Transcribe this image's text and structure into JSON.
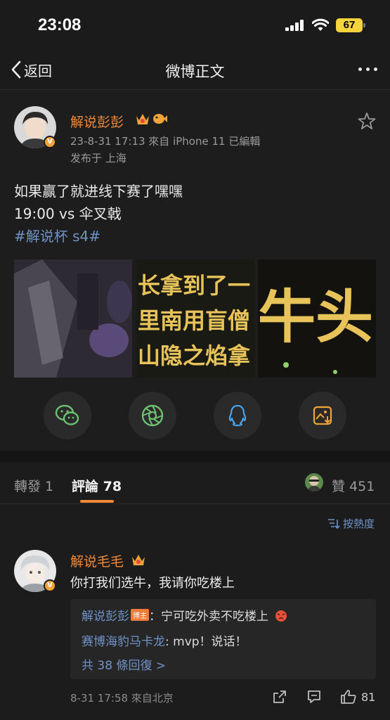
{
  "status": {
    "time": "23:08",
    "battery": "67"
  },
  "nav": {
    "back_label": "返回",
    "title": "微博正文"
  },
  "post": {
    "author": "解说彭彭",
    "verified": "V",
    "meta": "23-8-31 17:13  來自 iPhone 11  已編輯",
    "location": "发布于 上海",
    "text_line1": "如果赢了就进线下赛了嘿嘿",
    "text_line2": "19:00 vs 伞叉戟",
    "hashtag": "#解说杯 s4#",
    "images": [
      {
        "alt": "video-frame",
        "caption": ""
      },
      {
        "alt": "subtitle-frame",
        "caption": "长拿到了一\n里南用盲僧\n山隐之焰拿"
      },
      {
        "alt": "subtitle-frame",
        "caption": "牛头"
      }
    ],
    "share_targets": [
      "wechat-icon",
      "moments-icon",
      "qq-icon",
      "save-image-icon"
    ]
  },
  "tabs": {
    "repost": "轉發 1",
    "comments": "評論 78",
    "likes": "贊 451"
  },
  "sort": {
    "label": "按熱度"
  },
  "comment": {
    "author": "解说毛毛",
    "verified": "V",
    "text": "你打我们选牛，我请你吃楼上",
    "replies": [
      {
        "user": "解说彭彭",
        "tag": "博主",
        "text": "：宁可吃外卖不吃楼上"
      },
      {
        "user": "赛博海豹马卡龙",
        "tag": "",
        "text": ": mvp！说话！"
      }
    ],
    "more_replies": "共 38 條回復 >",
    "meta": "8-31 17:58  來自北京",
    "like_count": "81"
  },
  "colors": {
    "accent": "#f08a3a",
    "link": "#6f93c9",
    "background": "#1c1c1c"
  }
}
